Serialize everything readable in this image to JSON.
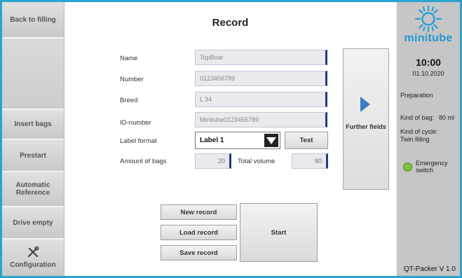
{
  "sidebar": {
    "back": "Back to filling",
    "insert_bags": "Insert bags",
    "prestart": "Prestart",
    "automatic_reference": "Automatic Reference",
    "drive_empty": "Drive empty",
    "configuration": "Configuration"
  },
  "main": {
    "title": "Record",
    "fields": {
      "name_label": "Name",
      "name_value": "TopBoar",
      "number_label": "Number",
      "number_value": "0123456789",
      "breed_label": "Breed",
      "breed_value": "L 34",
      "id_label": "ID-number",
      "id_value": "Minitube0123456789",
      "label_format_label": "Label format",
      "label_format_value": "Label 1",
      "amount_label": "Amount of bags",
      "amount_value": "20",
      "total_volume_label": "Total volume",
      "total_volume_value": "80"
    },
    "test_button": "Test",
    "further_fields": "Further fields",
    "new_record": "New record",
    "load_record": "Load record",
    "save_record": "Save record",
    "start": "Start"
  },
  "right_panel": {
    "brand": "minitube",
    "time": "10:00",
    "date": "01.10.2020",
    "status": "Preparation",
    "kind_of_bag_label": "Kind of bag:",
    "kind_of_bag_value": "80 ml",
    "kind_of_cycle_label": "Kind of cycle:",
    "kind_of_cycle_value": "Twin filling",
    "emergency_switch": "Emergency switch",
    "version": "QT-Packer V 1.0"
  },
  "colors": {
    "frame": "#2aa3cf",
    "field_accent": "#233d80",
    "play": "#3a7fc4",
    "emergency_led": "#7cc242"
  }
}
